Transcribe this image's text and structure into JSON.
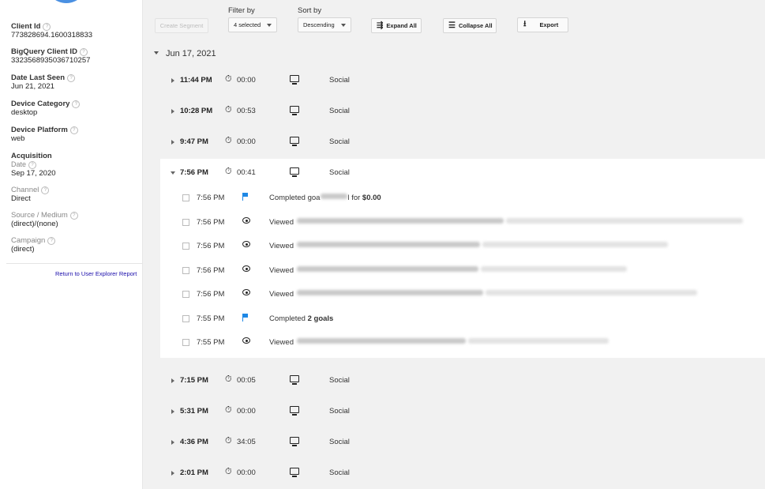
{
  "sidebar": {
    "client_id": {
      "label": "Client Id",
      "value": "773828694.1600318833"
    },
    "bq_client_id": {
      "label": "BigQuery Client ID",
      "value": "3323568935036710257"
    },
    "date_last_seen": {
      "label": "Date Last Seen",
      "value": "Jun 21, 2021"
    },
    "device_category": {
      "label": "Device Category",
      "value": "desktop"
    },
    "device_platform": {
      "label": "Device Platform",
      "value": "web"
    },
    "acquisition": {
      "label": "Acquisition",
      "date_label": "Date",
      "date_value": "Sep 17, 2020",
      "channel_label": "Channel",
      "channel_value": "Direct",
      "source_label": "Source / Medium",
      "source_value": "(direct)/(none)",
      "campaign_label": "Campaign",
      "campaign_value": "(direct)"
    },
    "return_link": "Return to User Explorer Report"
  },
  "toolbar": {
    "create_segment": "Create Segment",
    "filter_label": "Filter by",
    "filter_value": "4 selected",
    "sort_label": "Sort by",
    "sort_value": "Descending",
    "expand_all": "Expand All",
    "collapse_all": "Collapse All",
    "export": "Export"
  },
  "date_group": "Jun 17, 2021",
  "sessions_before": [
    {
      "time": "11:44 PM",
      "duration": "00:00",
      "channel": "Social"
    },
    {
      "time": "10:28 PM",
      "duration": "00:53",
      "channel": "Social"
    },
    {
      "time": "9:47 PM",
      "duration": "00:00",
      "channel": "Social"
    }
  ],
  "expanded_session": {
    "time": "7:56 PM",
    "duration": "00:41",
    "channel": "Social",
    "hits": [
      {
        "time": "7:56 PM",
        "icon": "flag-icon",
        "prefix": "Completed goa",
        "middle": "l for",
        "value": "$0.00"
      },
      {
        "time": "7:56 PM",
        "icon": "eye-icon",
        "prefix": "Viewed"
      },
      {
        "time": "7:56 PM",
        "icon": "eye-icon",
        "prefix": "Viewed"
      },
      {
        "time": "7:56 PM",
        "icon": "eye-icon",
        "prefix": "Viewed"
      },
      {
        "time": "7:56 PM",
        "icon": "eye-icon",
        "prefix": "Viewed"
      },
      {
        "time": "7:55 PM",
        "icon": "flag-icon",
        "prefix": "Completed",
        "value": "2 goals"
      },
      {
        "time": "7:55 PM",
        "icon": "eye-icon",
        "prefix": "Viewed"
      }
    ]
  },
  "sessions_after": [
    {
      "time": "7:15 PM",
      "duration": "00:05",
      "channel": "Social"
    },
    {
      "time": "5:31 PM",
      "duration": "00:00",
      "channel": "Social"
    },
    {
      "time": "4:36 PM",
      "duration": "34:05",
      "channel": "Social"
    },
    {
      "time": "2:01 PM",
      "duration": "00:00",
      "channel": "Social"
    }
  ],
  "colors": {
    "accent": "#1e88e5",
    "link": "#1a0dab",
    "avatar": "#4a90e2"
  },
  "icons": {
    "timer": "stopwatch-icon",
    "device": "desktop-icon",
    "expand": "expand-all-icon",
    "collapse": "collapse-all-icon",
    "export": "download-icon"
  }
}
